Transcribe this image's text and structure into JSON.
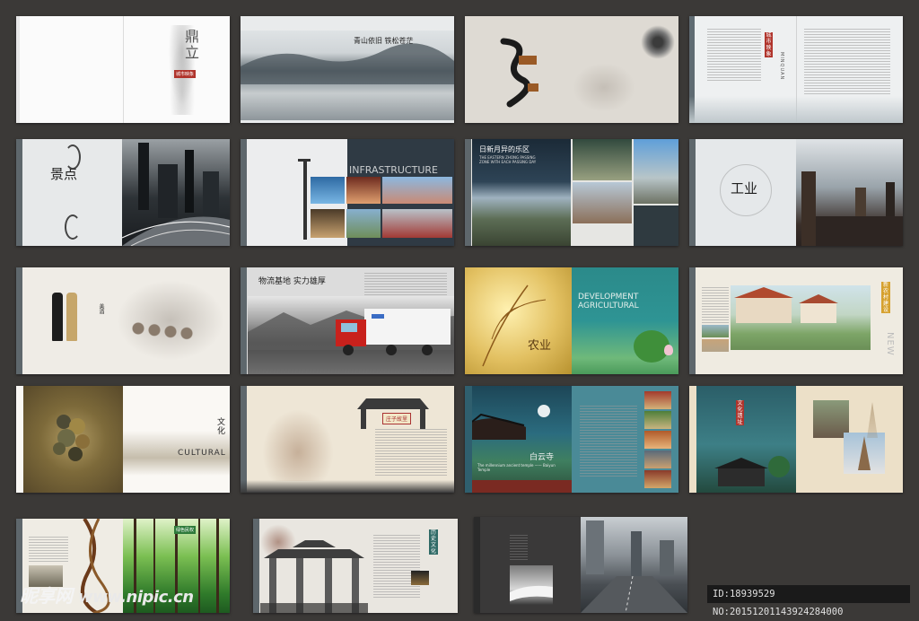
{
  "canvas": {
    "background": "#3b3937"
  },
  "spreads": [
    {
      "id": "cover",
      "calligraphy": "鼎立",
      "seal": "城市映象"
    },
    {
      "id": "landscape",
      "vertical_text": "青山依旧 铁松苍茫"
    },
    {
      "id": "ink-brush"
    },
    {
      "id": "text-page",
      "badge": "城市映象",
      "side_text": "MINQUAN"
    },
    {
      "id": "city-night",
      "calligraphy": "景点"
    },
    {
      "id": "infrastructure",
      "heading": "INFRASTRUCTURE"
    },
    {
      "id": "passing-zone",
      "heading": "日新月异的乐区",
      "subheading": "THE EASTERN ZHONG PASSING ZONE WITH EACH PASSING DAY"
    },
    {
      "id": "industry",
      "calligraphy": "工业"
    },
    {
      "id": "wine",
      "label": "美酒"
    },
    {
      "id": "logistics",
      "headline": "物流基地 实力雄厚"
    },
    {
      "id": "agricultural",
      "heading": "DEVELOPMENT AGRICULTURAL",
      "calligraphy": "农业"
    },
    {
      "id": "new-village",
      "badge": "新农村建设",
      "side_text": "NEW"
    },
    {
      "id": "cultural",
      "heading": "CULTURAL",
      "calligraphy": "文化"
    },
    {
      "id": "garden",
      "badge": "庄子故里"
    },
    {
      "id": "temple",
      "calligraphy": "白云寺",
      "caption": "The millennium ancient temple —— Baiyun Temple"
    },
    {
      "id": "pagoda",
      "badge": "文化遗址"
    },
    {
      "id": "forest",
      "badge": "绿色民权"
    },
    {
      "id": "archway",
      "badge": "历史文化"
    },
    {
      "id": "metro"
    }
  ],
  "watermark": {
    "brand": "昵享网",
    "url": "www.nipic.cn"
  },
  "id_bar": "ID:18939529 NO:20151201143924284000"
}
